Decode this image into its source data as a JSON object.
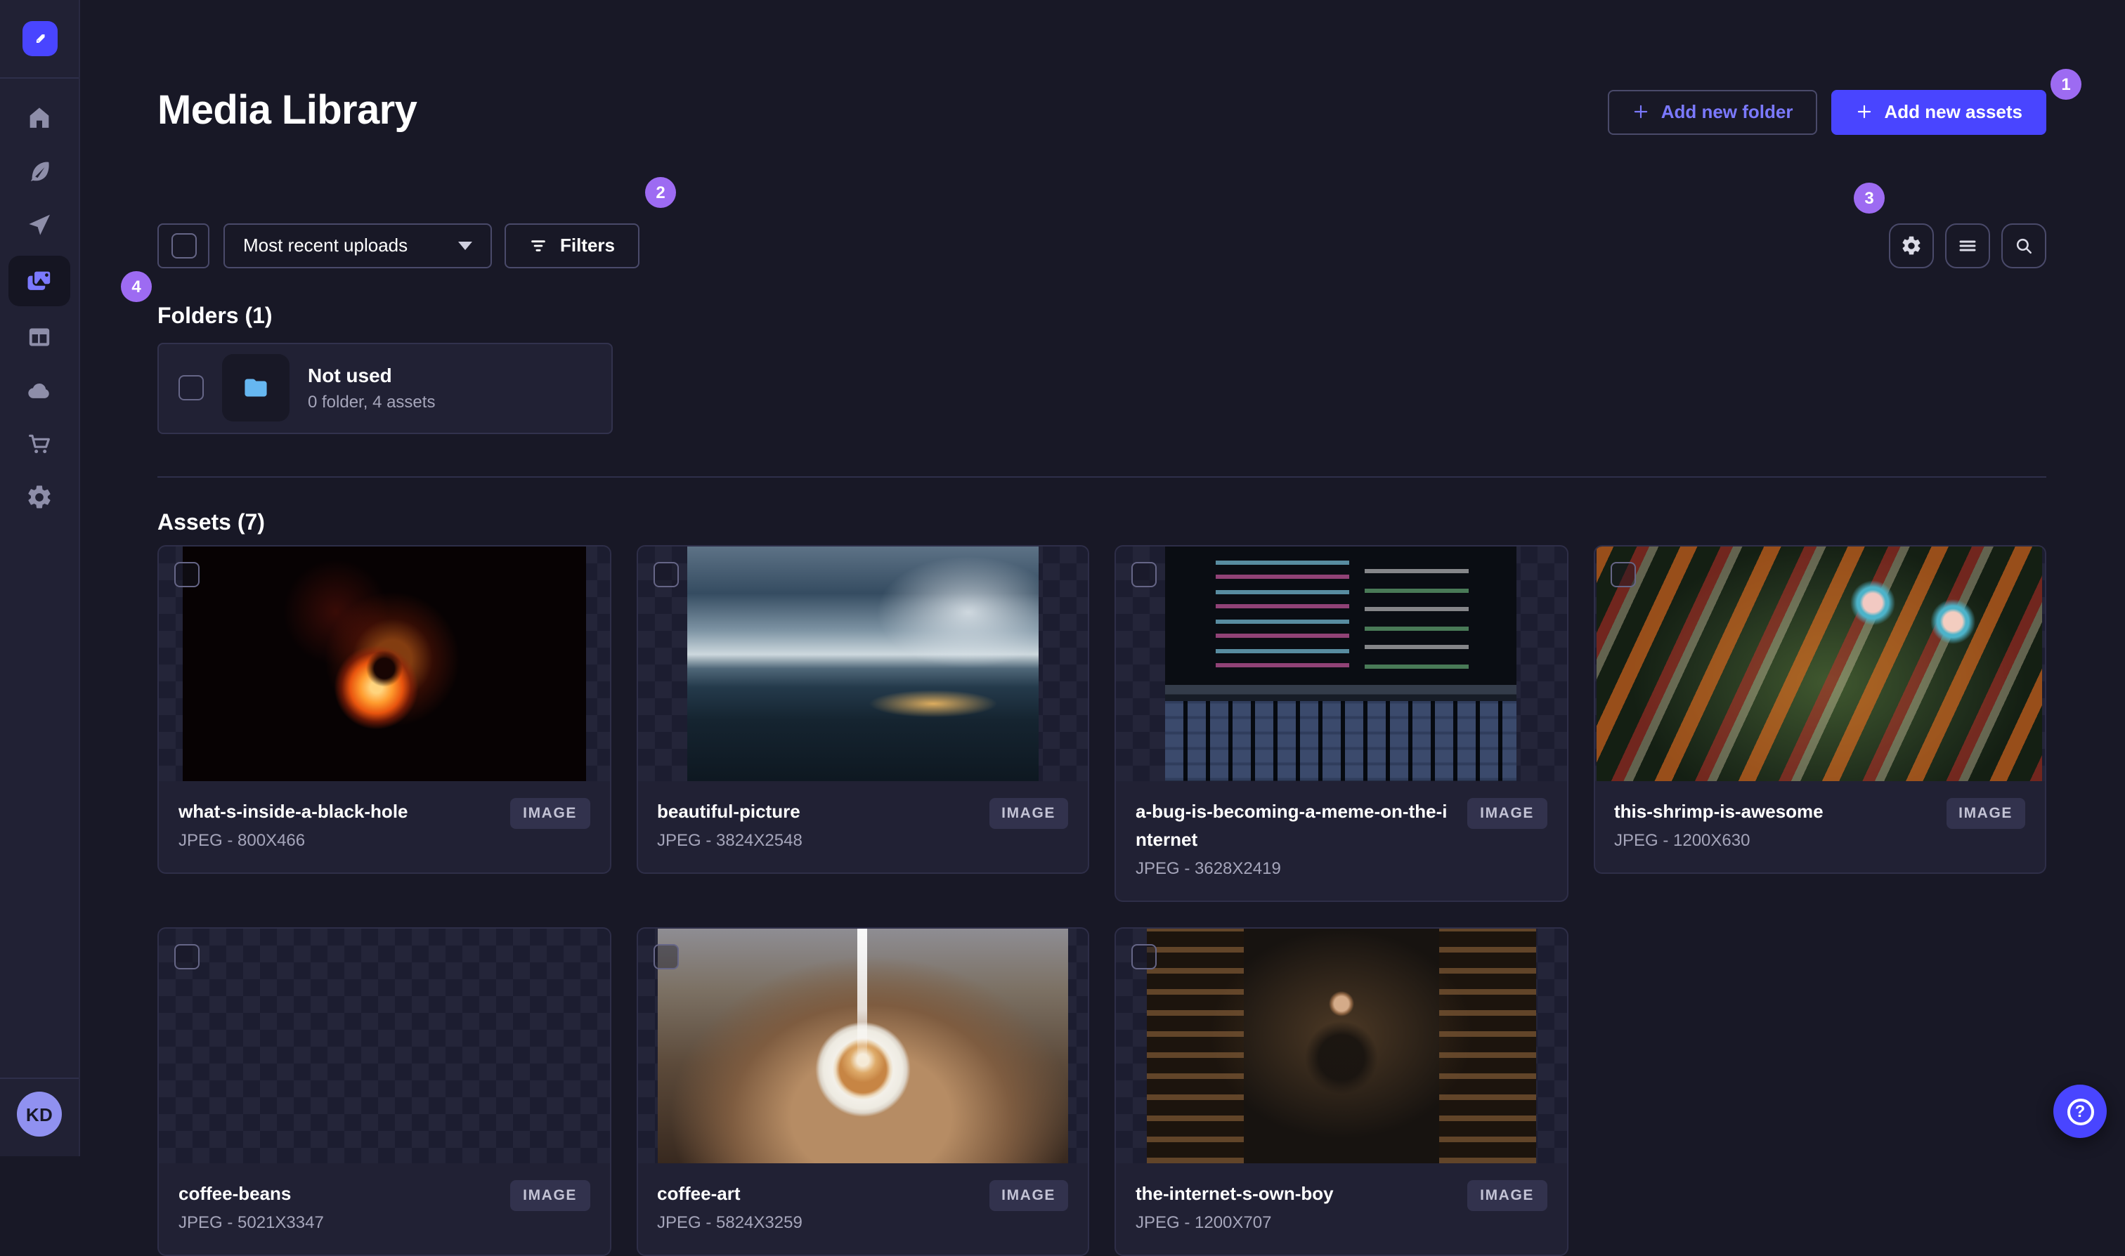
{
  "sidebar": {
    "logo_icon": "strapi-logo-icon",
    "icons": [
      "home-icon",
      "feather-icon",
      "paper-plane-icon",
      "images-icon",
      "layout-icon",
      "cloud-icon",
      "cart-icon",
      "gear-icon"
    ],
    "active_icon": "images-icon",
    "avatar_initials": "KD"
  },
  "header": {
    "title": "Media Library",
    "add_folder_label": "Add new folder",
    "add_assets_label": "Add new assets"
  },
  "toolbar": {
    "sort_value": "Most recent uploads",
    "filters_label": "Filters",
    "right_icons": [
      "gear-icon",
      "list-icon",
      "search-icon"
    ]
  },
  "annotations": {
    "one": "1",
    "two": "2",
    "three": "3",
    "four": "4"
  },
  "folders": {
    "heading": "Folders (1)",
    "items": [
      {
        "title": "Not used",
        "subtitle": "0 folder, 4 assets"
      }
    ]
  },
  "assets": {
    "heading": "Assets (7)",
    "type_badge": "IMAGE",
    "items": [
      {
        "title": "what-s-inside-a-black-hole",
        "meta": "JPEG - 800X466"
      },
      {
        "title": "beautiful-picture",
        "meta": "JPEG - 3824X2548"
      },
      {
        "title": "a-bug-is-becoming-a-meme-on-the-internet",
        "meta": "JPEG - 3628X2419"
      },
      {
        "title": "this-shrimp-is-awesome",
        "meta": "JPEG - 1200X630"
      },
      {
        "title": "coffee-beans",
        "meta": "JPEG - 5021X3347"
      },
      {
        "title": "coffee-art",
        "meta": "JPEG - 5824X3259"
      },
      {
        "title": "the-internet-s-own-boy",
        "meta": "JPEG - 1200X707"
      }
    ]
  },
  "help": {
    "icon_label": "?"
  },
  "colors": {
    "accent": "#4945ff",
    "accent_text": "#7b79ff",
    "annotation_badge": "#9d6bf2",
    "folder_blue": "#66b7f1",
    "background": "#181826",
    "panel": "#212134"
  }
}
